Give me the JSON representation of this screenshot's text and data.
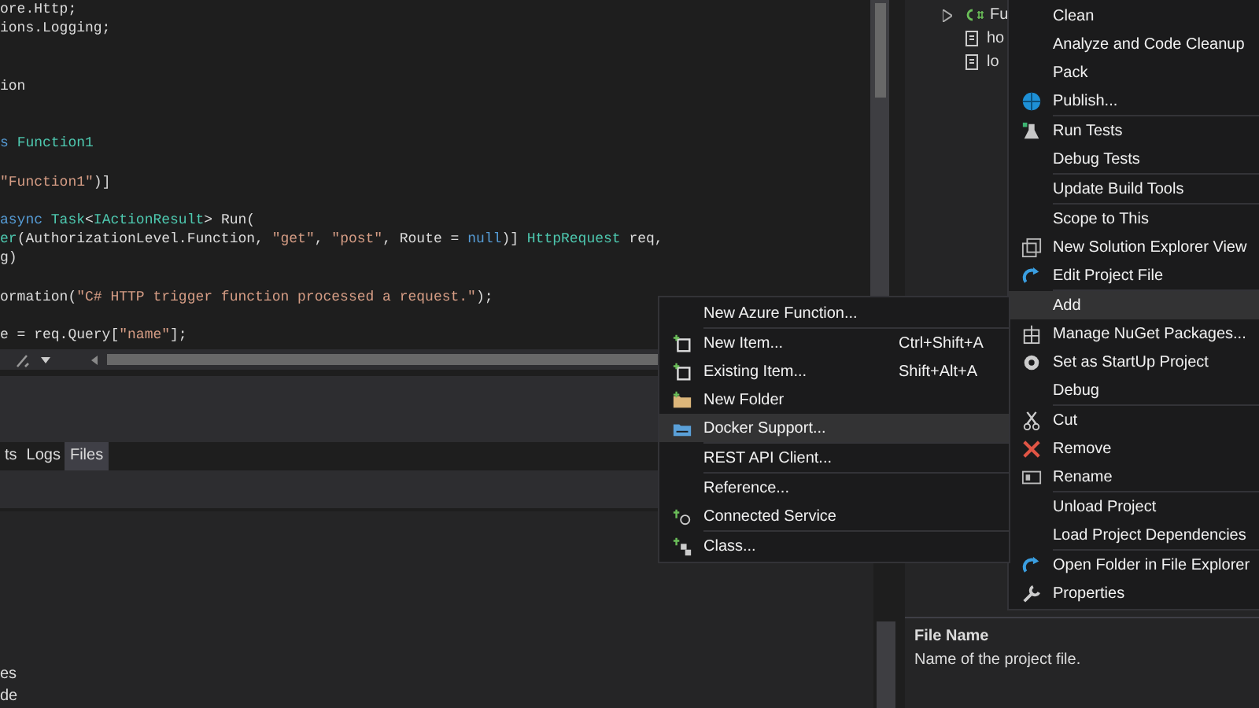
{
  "editor": {
    "blocks": [
      {
        "kind": "top",
        "lines": [
          [
            {
              "kind": "plain",
              "text": "ore.Http;"
            }
          ],
          [
            {
              "kind": "plain",
              "text": "ions.Logging;"
            }
          ]
        ]
      },
      {
        "kind": "wide",
        "lines": [
          [
            {
              "kind": "plain",
              "text": "ion"
            }
          ]
        ]
      },
      {
        "kind": "wide",
        "lines": [
          [
            {
              "kind": "keyword",
              "text": "s "
            },
            {
              "kind": "type",
              "text": "Function1"
            }
          ]
        ]
      },
      {
        "kind": "spaced",
        "lines": [
          [
            {
              "kind": "string",
              "text": "\"Function1\""
            },
            {
              "kind": "plain",
              "text": ")]"
            }
          ]
        ]
      },
      {
        "kind": "spaced",
        "lines": [
          [
            {
              "kind": "keyword",
              "text": "async "
            },
            {
              "kind": "type",
              "text": "Task"
            },
            {
              "kind": "plain",
              "text": "<"
            },
            {
              "kind": "type",
              "text": "IActionResult"
            },
            {
              "kind": "plain",
              "text": "> Run("
            }
          ],
          [
            {
              "kind": "type",
              "text": "er"
            },
            {
              "kind": "plain",
              "text": "(AuthorizationLevel.Function, "
            },
            {
              "kind": "string",
              "text": "\"get\""
            },
            {
              "kind": "plain",
              "text": ", "
            },
            {
              "kind": "string",
              "text": "\"post\""
            },
            {
              "kind": "plain",
              "text": ", Route = "
            },
            {
              "kind": "keyword",
              "text": "null"
            },
            {
              "kind": "plain",
              "text": ")] "
            },
            {
              "kind": "type",
              "text": "HttpRequest"
            },
            {
              "kind": "plain",
              "text": " req,"
            }
          ],
          [
            {
              "kind": "plain",
              "text": "g)"
            }
          ]
        ]
      },
      {
        "kind": "spaced",
        "lines": [
          [
            {
              "kind": "plain",
              "text": "ormation("
            },
            {
              "kind": "string",
              "text": "\"C# HTTP trigger function processed a request.\""
            },
            {
              "kind": "plain",
              "text": ");"
            }
          ]
        ]
      },
      {
        "kind": "spaced",
        "lines": [
          [
            {
              "kind": "plain",
              "text": "e = req.Query["
            },
            {
              "kind": "string",
              "text": "\"name\""
            },
            {
              "kind": "plain",
              "text": "];"
            }
          ]
        ]
      }
    ]
  },
  "output_panel": {
    "tabs": [
      {
        "label": "ts",
        "selected": false
      },
      {
        "label": "Logs",
        "selected": false
      },
      {
        "label": "Files",
        "selected": true
      }
    ],
    "items": [
      "es",
      "de"
    ]
  },
  "solution_explorer": {
    "items": [
      {
        "label": "Fu",
        "expanded": false,
        "kind": "csharp"
      },
      {
        "label": "ho",
        "kind": "file"
      },
      {
        "label": "lo",
        "kind": "file"
      }
    ],
    "description": {
      "title": "File Name",
      "text": "Name of the project file."
    }
  },
  "context_menu": {
    "groups": [
      [
        {
          "label": "Clean",
          "selected": false
        },
        {
          "label": "Analyze and Code Cleanup",
          "selected": false
        },
        {
          "label": "Pack",
          "selected": false
        },
        {
          "label": "Publish...",
          "selected": false
        }
      ],
      [
        {
          "label": "Run Tests",
          "selected": false
        },
        {
          "label": "Debug Tests",
          "selected": false
        }
      ],
      [
        {
          "label": "Update Build Tools",
          "selected": false
        }
      ],
      [
        {
          "label": "Scope to This",
          "selected": false
        },
        {
          "label": "New Solution Explorer View",
          "selected": false
        },
        {
          "label": "Edit Project File",
          "selected": false
        }
      ],
      [
        {
          "label": "Add",
          "selected": true
        },
        {
          "label": "Manage NuGet Packages...",
          "selected": false
        },
        {
          "label": "Set as StartUp Project",
          "selected": false
        },
        {
          "label": "Debug",
          "selected": false
        }
      ],
      [
        {
          "label": "Cut",
          "selected": false
        },
        {
          "label": "Remove",
          "selected": false
        },
        {
          "label": "Rename",
          "selected": false
        }
      ],
      [
        {
          "label": "Unload Project",
          "selected": false
        },
        {
          "label": "Load Project Dependencies",
          "selected": false
        }
      ],
      [
        {
          "label": "Open Folder in File Explorer",
          "selected": false
        },
        {
          "label": "Properties",
          "selected": false
        }
      ]
    ]
  },
  "add_submenu": {
    "groups": [
      [
        {
          "label": "New Azure Function...",
          "selected": false
        }
      ],
      [
        {
          "label": "New Item...",
          "shortcut": "Ctrl+Shift+A",
          "selected": false
        },
        {
          "label": "Existing Item...",
          "shortcut": "Shift+Alt+A",
          "selected": false
        },
        {
          "label": "New Folder",
          "selected": false
        },
        {
          "label": "Docker Support...",
          "selected": true
        }
      ],
      [
        {
          "label": "REST API Client...",
          "selected": false
        }
      ],
      [
        {
          "label": "Reference...",
          "selected": false
        },
        {
          "label": "Connected Service",
          "selected": false
        }
      ],
      [
        {
          "label": "Class...",
          "selected": false
        }
      ]
    ]
  }
}
